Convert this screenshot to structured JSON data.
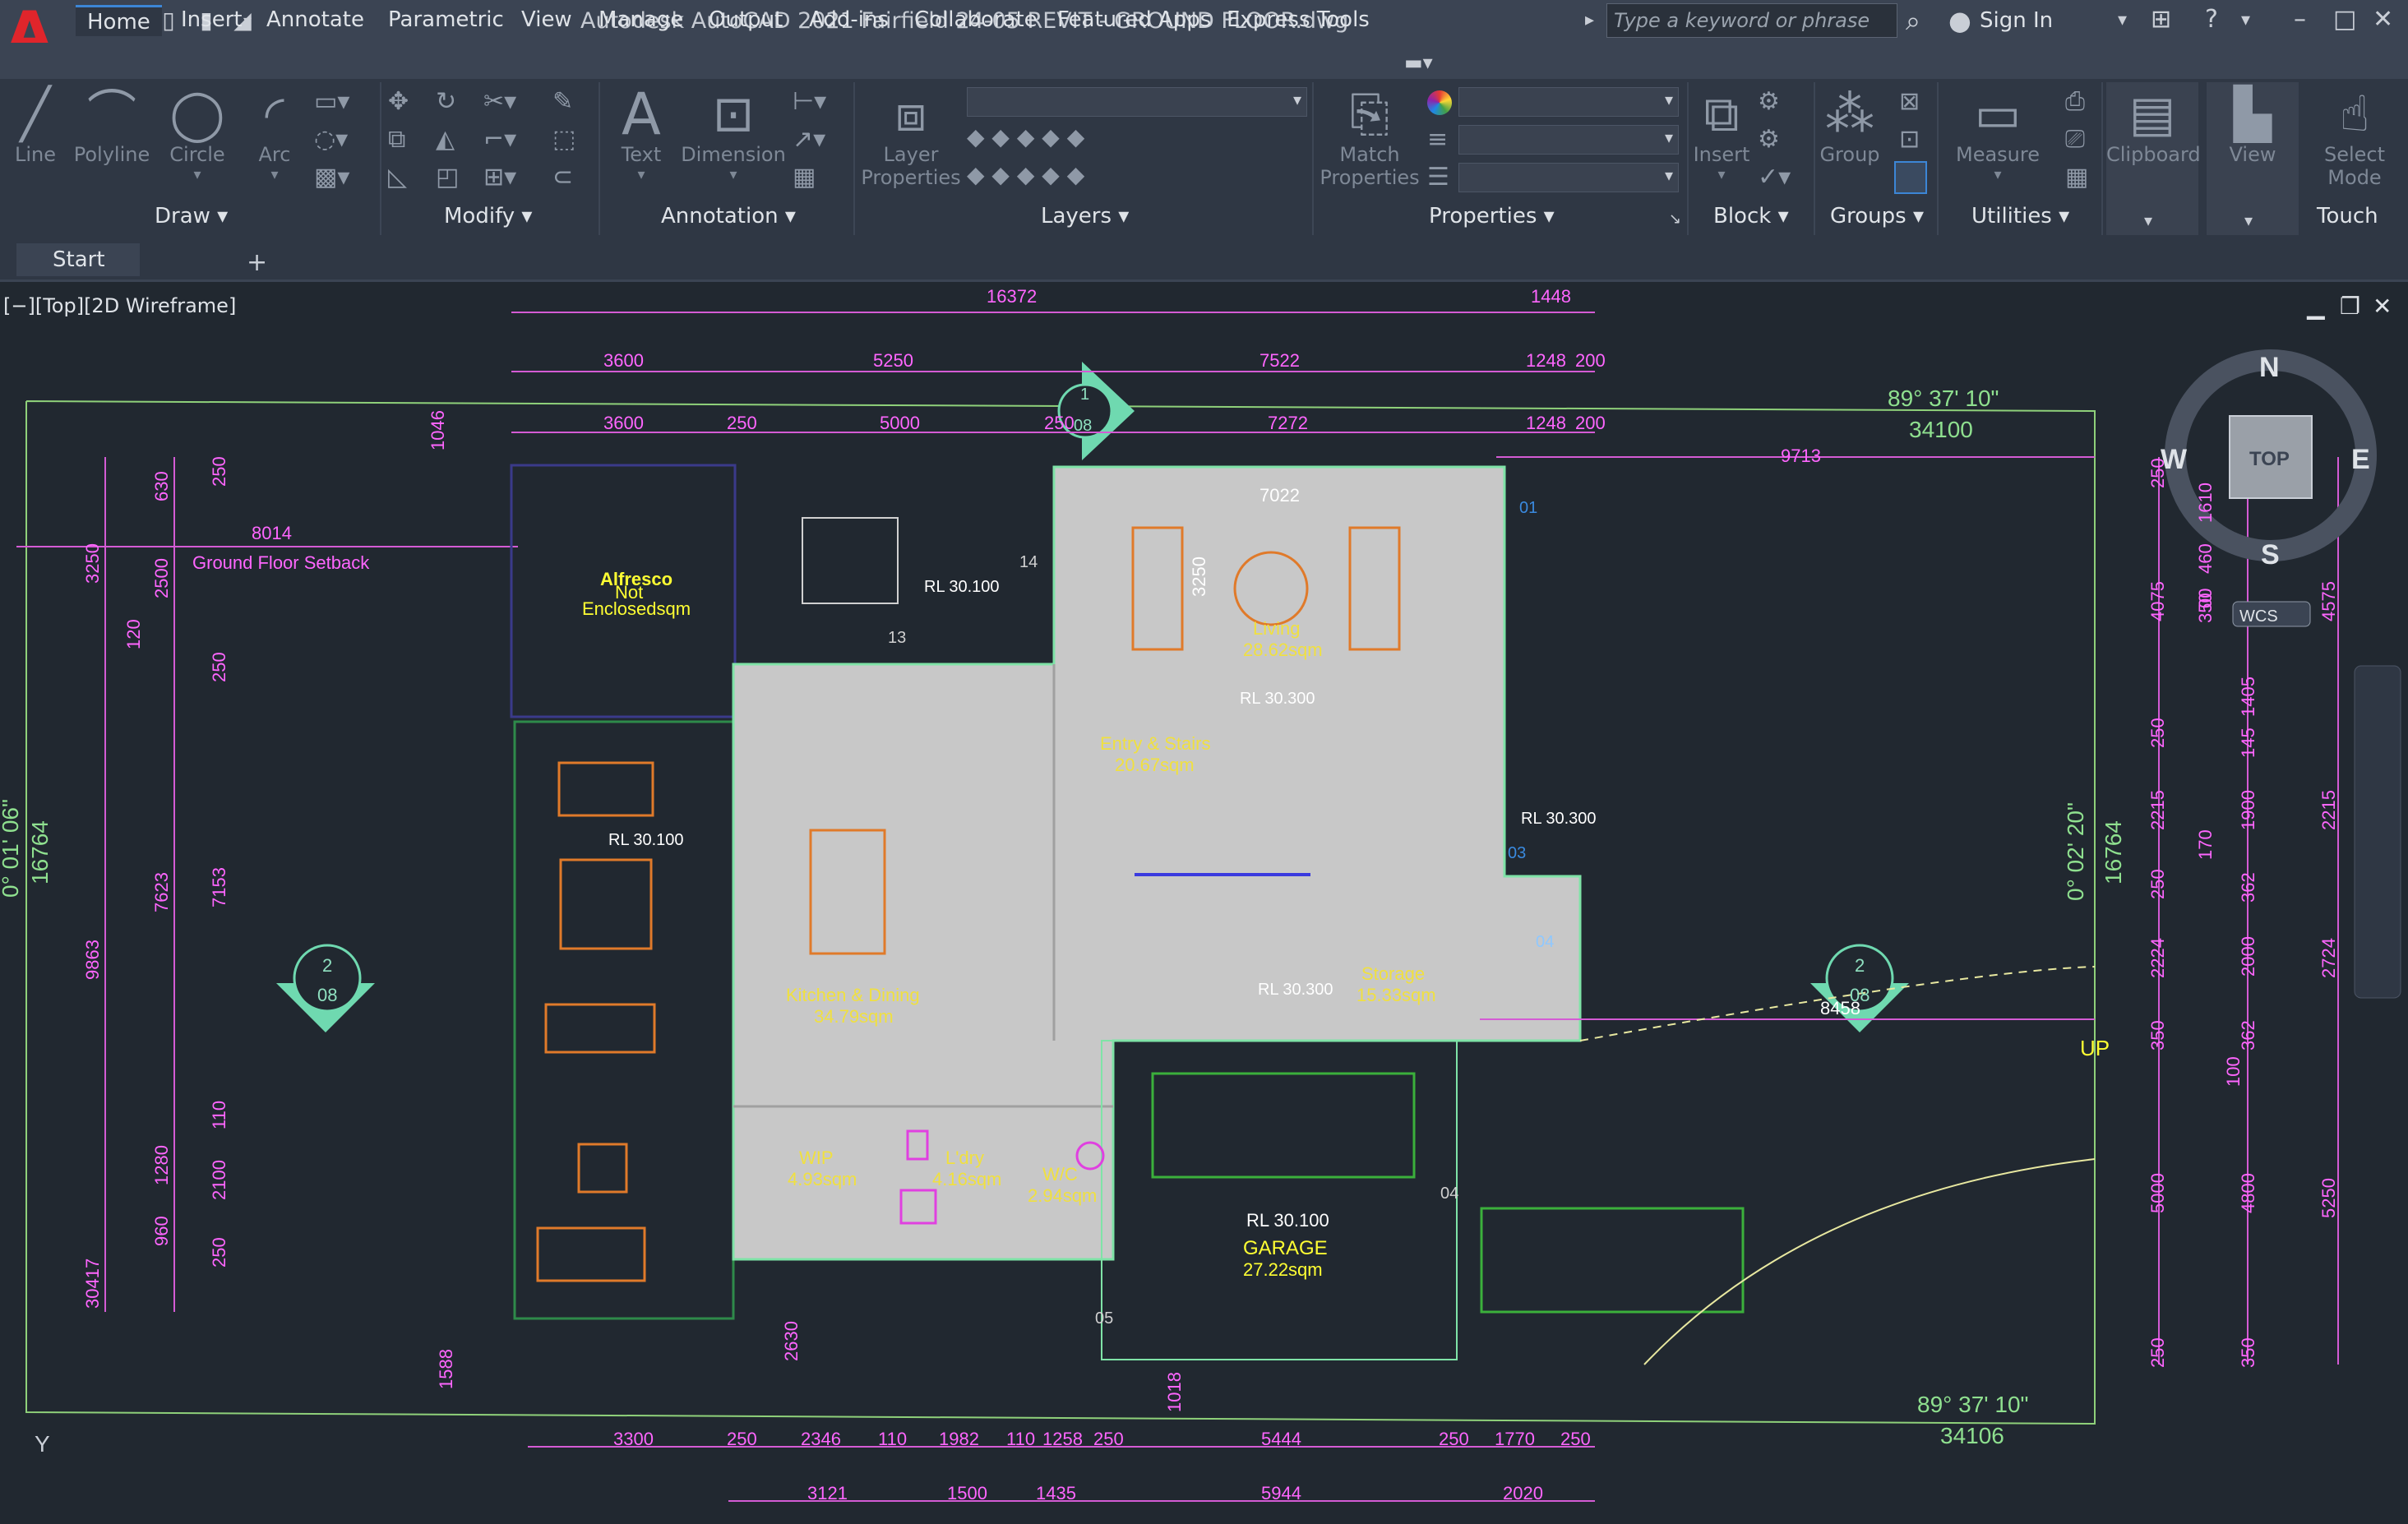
{
  "window": {
    "title": "Autodesk AutoCAD 2021    Fairfield 24-05 REVIT - GROUND FLOOR.dwg",
    "search_placeholder": "Type a keyword or phrase",
    "sign_in": "Sign In",
    "logo_letter": "A"
  },
  "tabs": [
    "Home",
    "Insert",
    "Annotate",
    "Parametric",
    "View",
    "Manage",
    "Output",
    "Add-ins",
    "Collaborate",
    "Featured Apps",
    "Express Tools"
  ],
  "ribbon": {
    "draw": {
      "title": "Draw",
      "line": "Line",
      "polyline": "Polyline",
      "circle": "Circle",
      "arc": "Arc"
    },
    "modify": {
      "title": "Modify"
    },
    "annotation": {
      "title": "Annotation",
      "text": "Text",
      "dimension": "Dimension"
    },
    "layers": {
      "title": "Layers",
      "layer_properties_1": "Layer",
      "layer_properties_2": "Properties"
    },
    "properties": {
      "title": "Properties",
      "match_1": "Match",
      "match_2": "Properties"
    },
    "block": {
      "title": "Block",
      "insert": "Insert"
    },
    "groups": {
      "title": "Groups",
      "group": "Group"
    },
    "utilities": {
      "title": "Utilities",
      "measure": "Measure"
    },
    "clipboard": {
      "label": "Clipboard"
    },
    "view": {
      "label": "View"
    },
    "touch": {
      "title": "Touch",
      "select_1": "Select",
      "select_2": "Mode"
    }
  },
  "file_tabs": {
    "start": "Start",
    "plus": "+"
  },
  "viewport": {
    "label": "[−][Top][2D Wireframe]"
  },
  "viewcube": {
    "n": "N",
    "s": "S",
    "e": "E",
    "w": "W",
    "top": "TOP",
    "wcs": "WCS"
  },
  "drawing": {
    "rooms": {
      "alfresco_1": "Alfresco",
      "alfresco_2": "Not",
      "alfresco_3": "Enclosedsqm",
      "living": "Living",
      "living_area": "28.62sqm",
      "entry": "Entry & Stairs",
      "entry_area": "20.67sqm",
      "kitchen": "Kitchen & Dining",
      "kitchen_area": "34.79sqm",
      "storage": "Storage",
      "storage_area": "15.33sqm",
      "wip": "WIP",
      "wip_area": "4.93sqm",
      "ldry": "L'dry",
      "ldry_area": "4.16sqm",
      "wc": "W/C",
      "wc_area": "2.94sqm",
      "garage_rl": "RL 30.100",
      "garage": "GARAGE",
      "garage_area": "27.22sqm"
    },
    "rl": {
      "alfresco_side": "RL 30.100",
      "living": "RL 30.300",
      "east": "RL 30.300",
      "kitchen": "RL 30.300",
      "left": "RL 30.100"
    },
    "setback": "Ground Floor Setback",
    "up": "UP",
    "bearings": {
      "top": "89° 37' 10\"",
      "top_len": "34100",
      "bottom": "89° 37' 10\"",
      "bottom_len": "34106",
      "left": "0° 01' 06\"",
      "left_len": "16764",
      "right": "0° 02' 20\"",
      "right_len": "16764"
    },
    "markers": {
      "m1": "1",
      "m1b": "08",
      "m2l": "2",
      "m2lb": "08",
      "m2r": "2",
      "m2rb": "08"
    },
    "tags": {
      "t01": "01",
      "t03": "03",
      "t04a": "04",
      "t04b": "04",
      "t05": "05",
      "t13": "13",
      "t14": "14"
    },
    "dims_top": {
      "r1": [
        "16372",
        "1448"
      ],
      "r2": [
        "3600",
        "5250",
        "7522",
        "1248",
        "200"
      ],
      "r3": [
        "3600",
        "250",
        "5000",
        "250",
        "7272",
        "1248",
        "200"
      ],
      "misc": [
        "8014",
        "9713",
        "7022",
        "3250",
        "8458"
      ]
    },
    "dims_bottom": {
      "r1": [
        "3300",
        "250",
        "2346",
        "110",
        "1982",
        "110",
        "1258",
        "250",
        "5444",
        "250",
        "1770",
        "250"
      ],
      "r2": [
        "3121",
        "1500",
        "1435",
        "5944",
        "2020"
      ]
    },
    "dims_left": [
      "1046",
      "630",
      "250",
      "3250",
      "2500",
      "120",
      "250",
      "9863",
      "7623",
      "7153",
      "110",
      "1280",
      "2100",
      "960",
      "250",
      "30417",
      "2630",
      "1588",
      "1018"
    ],
    "dims_right": [
      "250",
      "460",
      "4075",
      "4575",
      "250",
      "1405",
      "145",
      "350",
      "2215",
      "2215",
      "1900",
      "170",
      "250",
      "362",
      "2224",
      "2000",
      "2724",
      "350",
      "362",
      "100",
      "5000",
      "4800",
      "5250",
      "250",
      "350",
      "1610",
      "00"
    ]
  }
}
